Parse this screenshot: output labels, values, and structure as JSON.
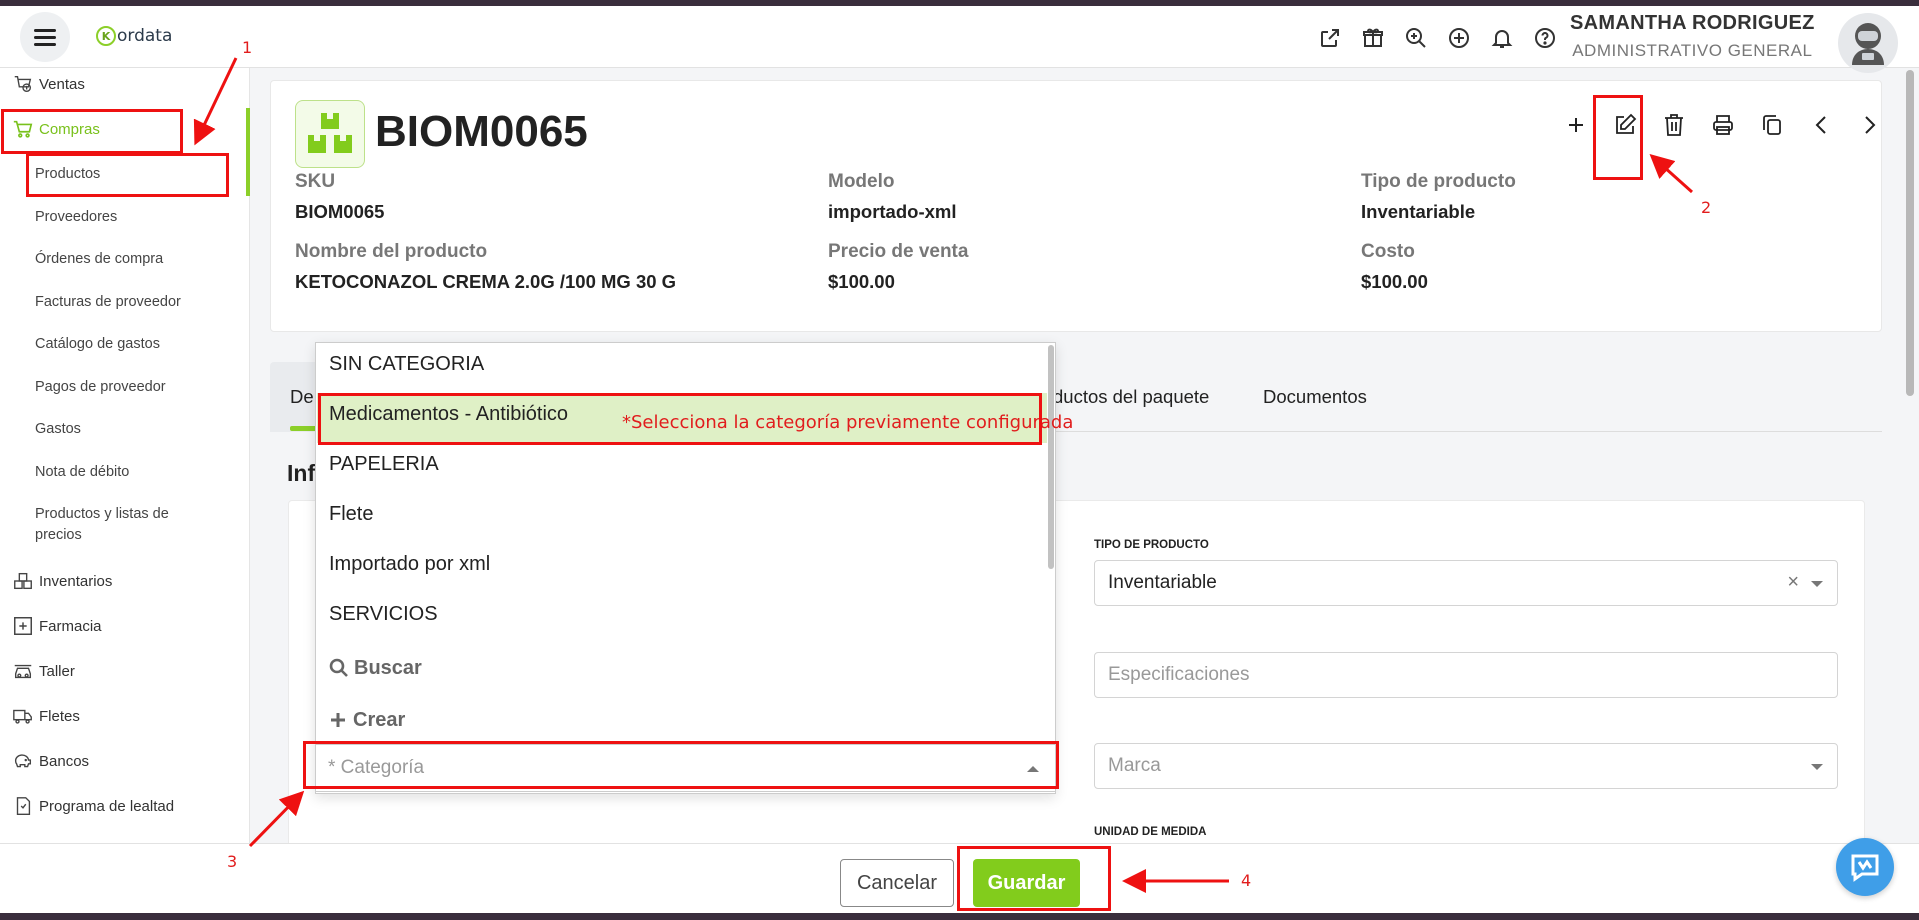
{
  "topbar": {
    "logo_text": "ordata",
    "logo_mark": "K",
    "user_name": "SAMANTHA RODRIGUEZ",
    "user_role": "ADMINISTRATIVO GENERAL",
    "icons": [
      "external-link-icon",
      "gift-icon",
      "search-zoom-icon",
      "plus-circle-icon",
      "bell-icon",
      "help-icon"
    ]
  },
  "sidebar": {
    "ventas": "Ventas",
    "compras": "Compras",
    "sub": [
      "Productos",
      "Proveedores",
      "Órdenes de compra",
      "Facturas de proveedor",
      "Catálogo de gastos",
      "Pagos de proveedor",
      "Gastos",
      "Nota de débito",
      "Productos y listas de",
      "precios"
    ],
    "inventarios": "Inventarios",
    "farmacia": "Farmacia",
    "taller": "Taller",
    "fletes": "Fletes",
    "bancos": "Bancos",
    "lealtad": "Programa de lealtad"
  },
  "product": {
    "title": "BIOM0065",
    "sku_label": "SKU",
    "sku_value": "BIOM0065",
    "modelo_label": "Modelo",
    "modelo_value": "importado-xml",
    "tipo_label": "Tipo de producto",
    "tipo_value": "Inventariable",
    "nombre_label": "Nombre del producto",
    "nombre_value": "KETOCONAZOL CREMA 2.0G /100 MG 30 G",
    "precio_label": "Precio de venta",
    "precio_value": "$100.00",
    "costo_label": "Costo",
    "costo_value": "$100.00"
  },
  "tabs": {
    "first": "De",
    "paquete": "ductos del paquete",
    "documentos": "Documentos"
  },
  "section": {
    "title": "Inf"
  },
  "form": {
    "tipo_label": "TIPO DE PRODUCTO",
    "tipo_value": "Inventariable",
    "tipo_clear": "×",
    "especificaciones_placeholder": "Especificaciones",
    "marca_placeholder": "Marca",
    "unidad_label": "UNIDAD DE MEDIDA",
    "categoria_placeholder": "* Categoría"
  },
  "dropdown": {
    "items": [
      "SIN CATEGORIA",
      "Medicamentos - Antibiótico",
      "PAPELERIA",
      "Flete",
      "Importado por xml",
      "SERVICIOS"
    ],
    "buscar": "Buscar",
    "crear": "Crear"
  },
  "hint": "*Selecciona la categoría previamente configurada",
  "footer": {
    "cancel": "Cancelar",
    "save": "Guardar"
  },
  "annotations": [
    "1",
    "2",
    "3",
    "4"
  ],
  "colors": {
    "accent": "#82cc1c",
    "annotation": "#ee1111",
    "selected_bg": "#dff0c6"
  }
}
